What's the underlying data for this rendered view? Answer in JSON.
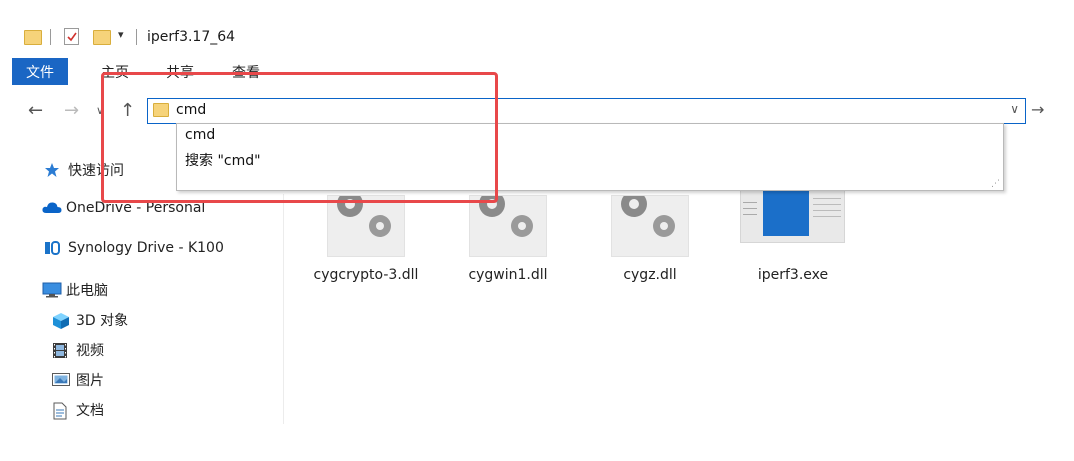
{
  "window": {
    "title": "iperf3.17_64"
  },
  "ribbon": {
    "tabs": [
      "文件",
      "主页",
      "共享",
      "查看"
    ]
  },
  "nav": {
    "back": "←",
    "forward": "→",
    "recent": "∨",
    "up": "↑"
  },
  "address": {
    "value": "cmd",
    "go": "→",
    "dropdown": "∨"
  },
  "suggestions": [
    "cmd",
    "搜索 \"cmd\""
  ],
  "sidebar": {
    "items": [
      {
        "label": "快速访问",
        "icon": "star-icon"
      },
      {
        "label": "OneDrive - Personal",
        "icon": "cloud-icon"
      },
      {
        "label": "Synology Drive - K100",
        "icon": "synology-drive-icon"
      },
      {
        "label": "此电脑",
        "icon": "computer-icon"
      },
      {
        "label": "3D 对象",
        "icon": "3d-objects-icon"
      },
      {
        "label": "视频",
        "icon": "video-icon"
      },
      {
        "label": "图片",
        "icon": "pictures-icon"
      },
      {
        "label": "文档",
        "icon": "documents-icon"
      }
    ]
  },
  "files": [
    {
      "name": "cygcrypto-3.dll",
      "icon": "dll-gear-icon"
    },
    {
      "name": "cygwin1.dll",
      "icon": "dll-gear-icon"
    },
    {
      "name": "cygz.dll",
      "icon": "dll-gear-icon"
    },
    {
      "name": "iperf3.exe",
      "icon": "exe-window-icon"
    }
  ],
  "colors": {
    "accent": "#1a66c4",
    "highlight": "#e8484a",
    "folder": "#f6d37a"
  }
}
